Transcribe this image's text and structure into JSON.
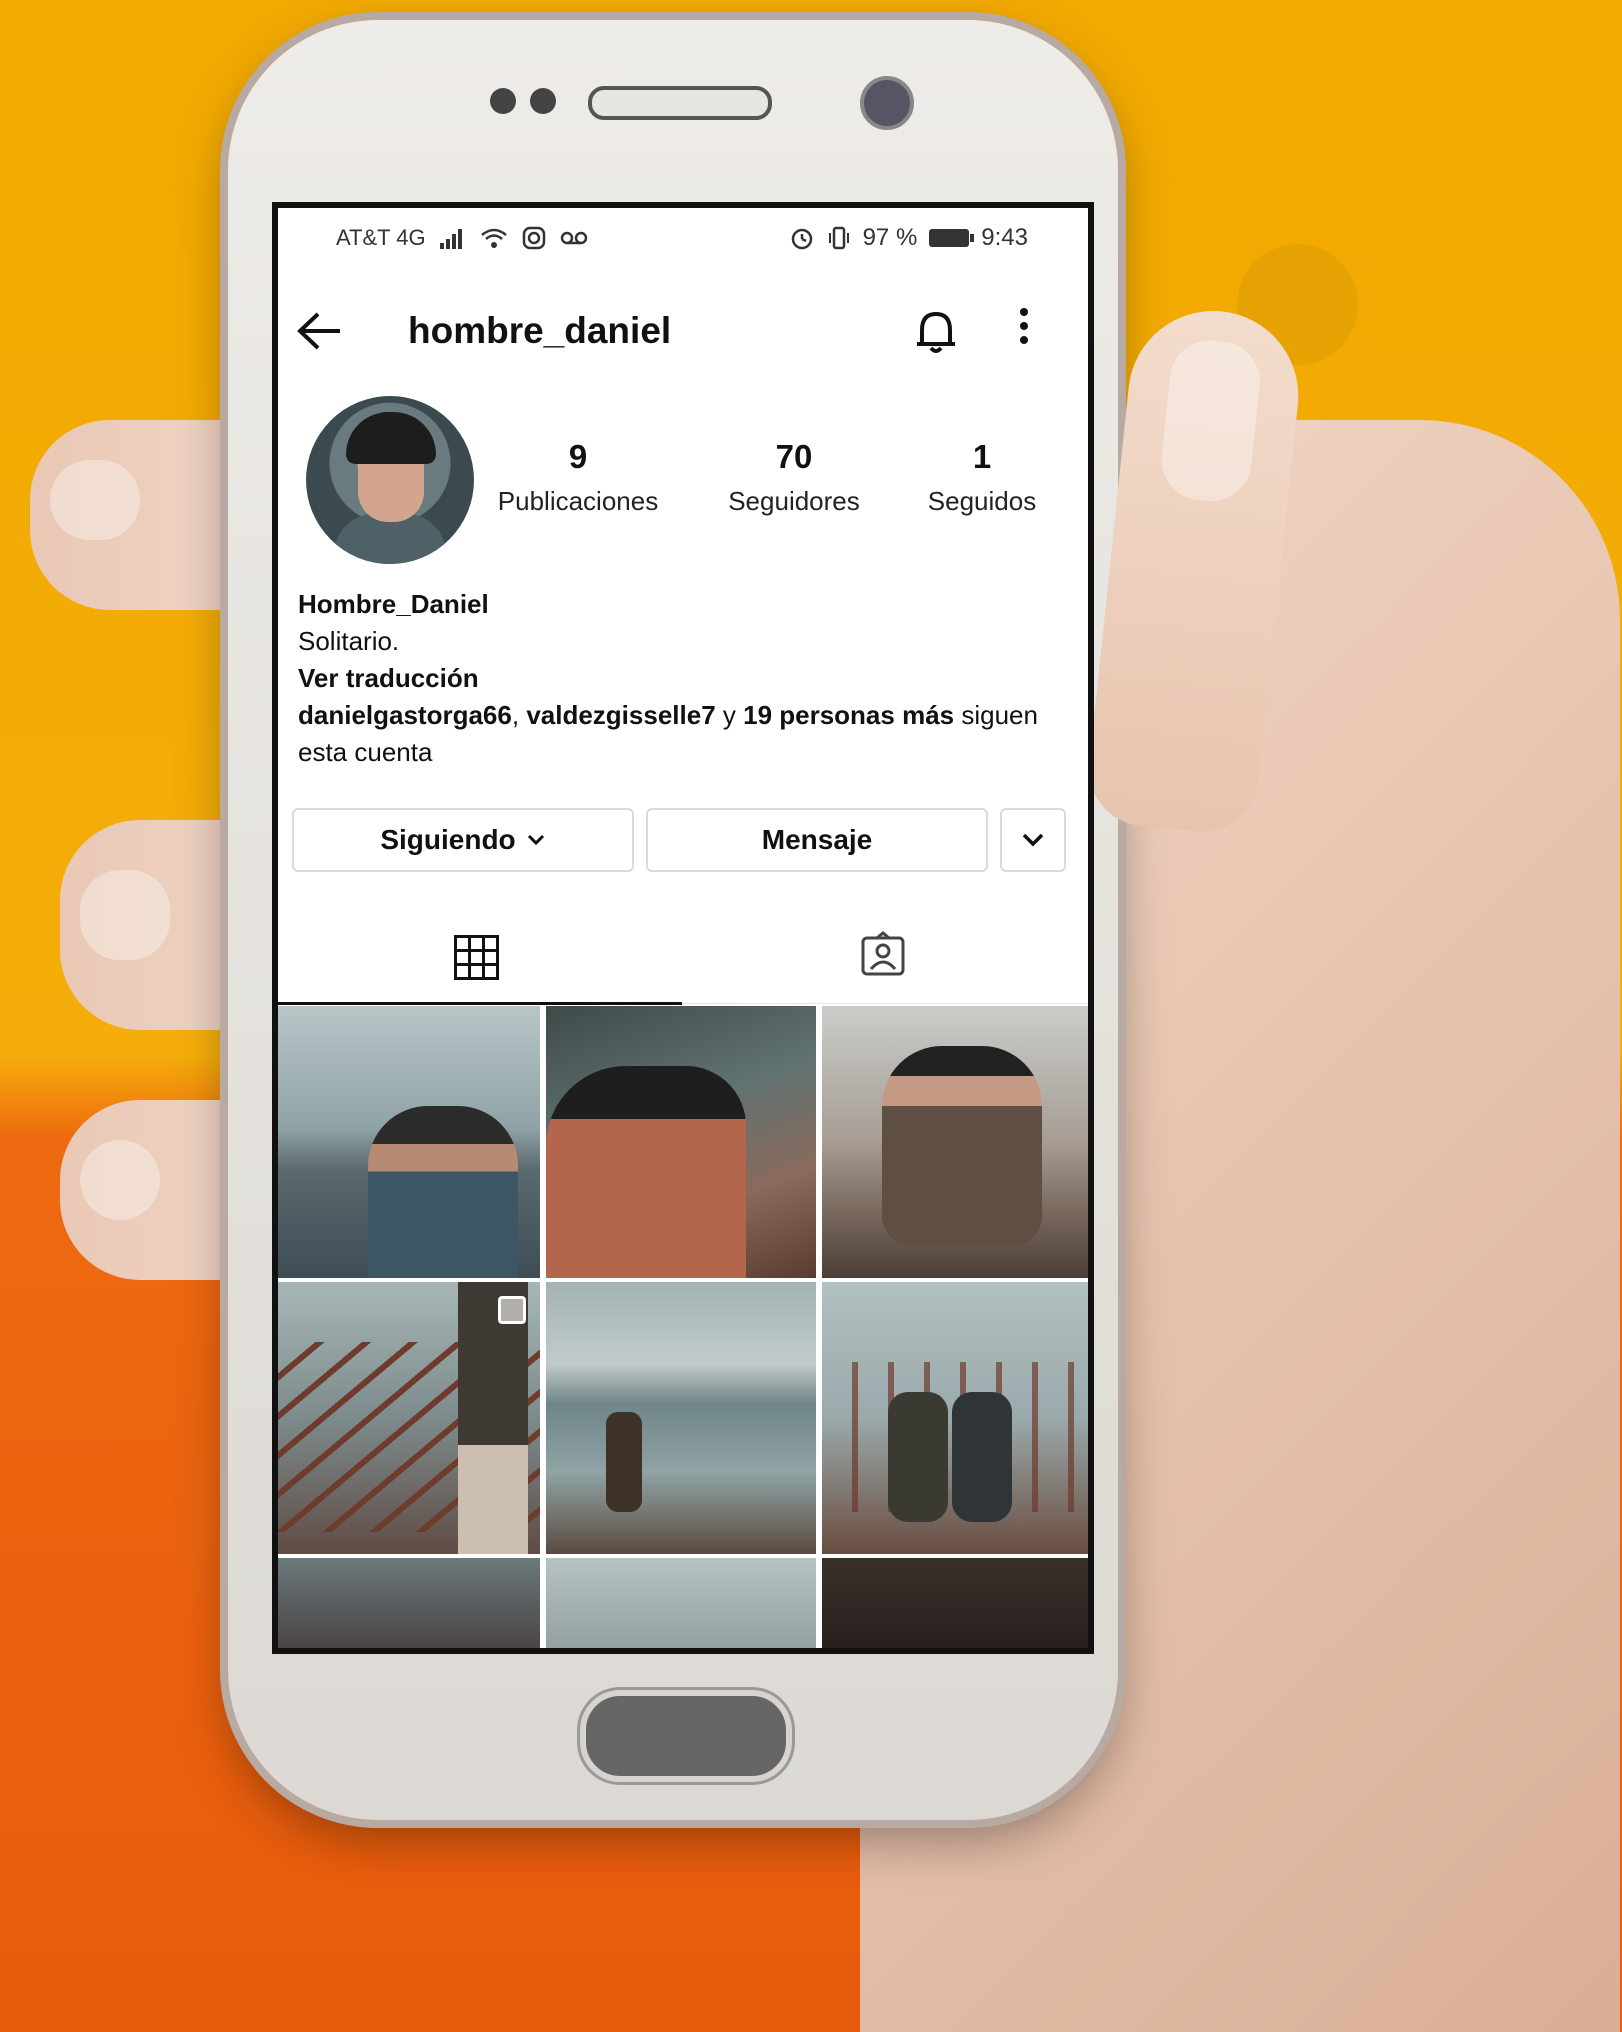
{
  "status_bar": {
    "carrier": "AT&T 4G",
    "battery": "97 %",
    "time": "9:43"
  },
  "header": {
    "username": "hombre_daniel"
  },
  "stats": [
    {
      "number": "9",
      "label": "Publicaciones"
    },
    {
      "number": "70",
      "label": "Seguidores"
    },
    {
      "number": "1",
      "label": "Seguidos"
    }
  ],
  "bio": {
    "name": "Hombre_Daniel",
    "text": "Solitario.",
    "translate": "Ver traducción",
    "followed_by_1": "danielgastorga66",
    "sep": ", ",
    "followed_by_2": "valdezgisselle7",
    "and": " y ",
    "others": "19 personas más",
    "suffix": " siguen esta cuenta"
  },
  "buttons": {
    "following": "Siguiendo",
    "message": "Mensaje"
  },
  "icons": {
    "back": "arrow-left-icon",
    "bell": "bell-icon",
    "more": "more-vertical-icon",
    "grid": "grid-icon",
    "tagged": "tagged-person-icon"
  },
  "colors": {
    "text": "#111111",
    "border": "#dbdbdb",
    "wall_top": "#f2a900",
    "wall_bottom": "#e85a0c"
  }
}
